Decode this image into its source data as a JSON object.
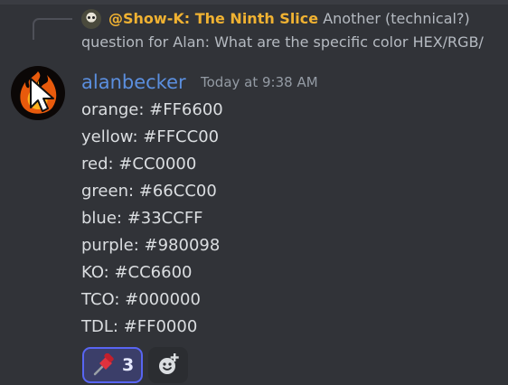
{
  "reply": {
    "author": "@Show-K: The Ninth Slice",
    "text_line1": "Another (technical?)",
    "text_line2": "question for Alan: What are the specific color HEX/RGB/"
  },
  "message": {
    "username": "alanbecker",
    "timestamp": "Today at 9:38 AM",
    "lines": [
      "orange: #FF6600",
      "yellow: #FFCC00",
      "red: #CC0000",
      "green: #66CC00",
      "blue: #33CCFF",
      "purple: #980098",
      "KO: #CC6600",
      "TCO: #000000",
      "TDL: #FF0000"
    ]
  },
  "reactions": [
    {
      "icon": "pushpin-icon",
      "count": "3",
      "active": true
    },
    {
      "icon": "add-reaction-icon"
    }
  ],
  "colors": {
    "background": "#313338",
    "username": "#5b8fdf",
    "reply_author": "#f0b232",
    "reaction_active_border": "#5865f2"
  }
}
